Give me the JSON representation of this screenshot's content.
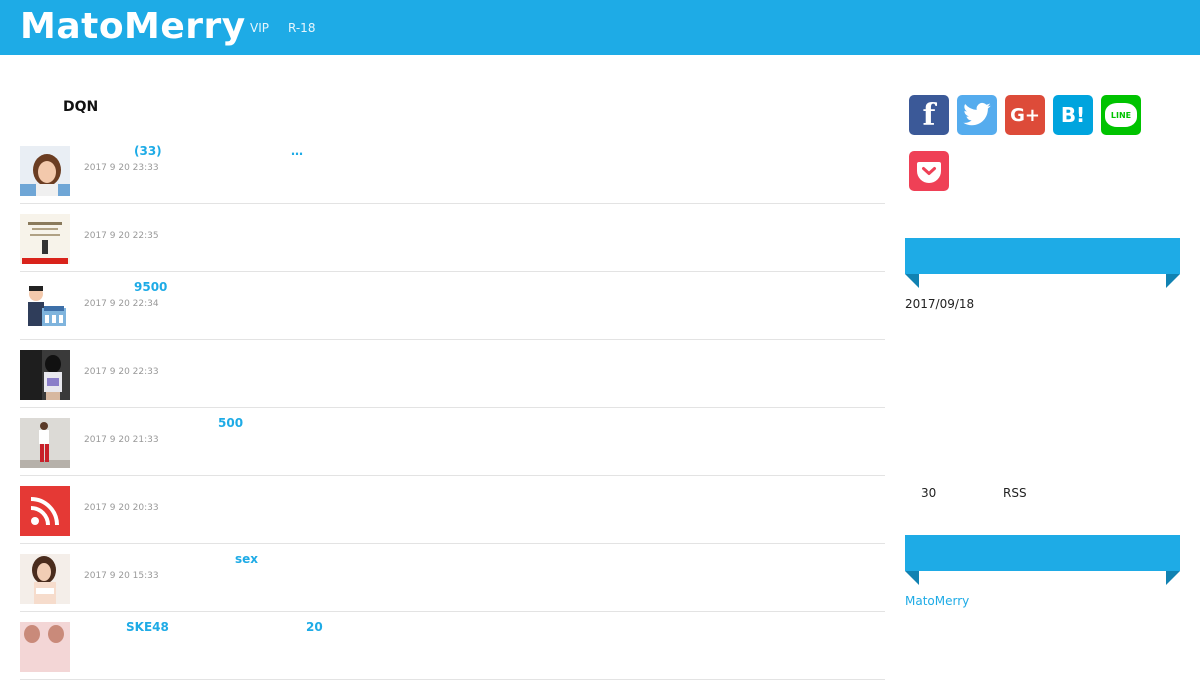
{
  "header": {
    "logo": "MatoMerry",
    "nav": [
      {
        "label": "VIP"
      },
      {
        "label": "R-18"
      }
    ]
  },
  "main": {
    "section_title": "DQN",
    "items": [
      {
        "title": "(33)",
        "title_extra": "…",
        "date": "2017 9 20 23:33",
        "thumb": "photo-woman-icon"
      },
      {
        "title": "",
        "title_extra": "",
        "date": "2017 9 20 22:35",
        "thumb": "document-icon"
      },
      {
        "title": "9500",
        "title_extra": "",
        "date": "2017 9 20 22:34",
        "thumb": "bank-man-icon"
      },
      {
        "title": "",
        "title_extra": "",
        "date": "2017 9 20 22:33",
        "thumb": "photo-people-icon"
      },
      {
        "title": "500",
        "title_extra": "",
        "date": "2017 9 20 21:33",
        "thumb": "photo-person-icon"
      },
      {
        "title": "",
        "title_extra": "",
        "date": "2017 9 20 20:33",
        "thumb": "rss-icon"
      },
      {
        "title": "sex",
        "title_extra": "",
        "date": "2017 9 20 15:33",
        "thumb": "photo-woman-icon"
      },
      {
        "title": "SKE48",
        "title_extra": "20",
        "date": "",
        "thumb": "photo-icon"
      }
    ]
  },
  "sidebar": {
    "share_buttons": [
      {
        "icon": "facebook-icon",
        "glyph": "f",
        "color": "#3b5998"
      },
      {
        "icon": "twitter-icon",
        "glyph": "🐦",
        "color": "#55acee"
      },
      {
        "icon": "google-plus-icon",
        "glyph": "G+",
        "color": "#dd4b39"
      },
      {
        "icon": "hatena-bookmark-icon",
        "glyph": "B!",
        "color": "#00a4de"
      },
      {
        "icon": "line-icon",
        "glyph": "LINE",
        "color": "#00c300"
      },
      {
        "icon": "pocket-icon",
        "glyph": "⌄",
        "color": "#ef4056"
      }
    ],
    "date": "2017/09/18",
    "rss_count": "30",
    "rss_label": "RSS",
    "site_link": "MatoMerry"
  }
}
